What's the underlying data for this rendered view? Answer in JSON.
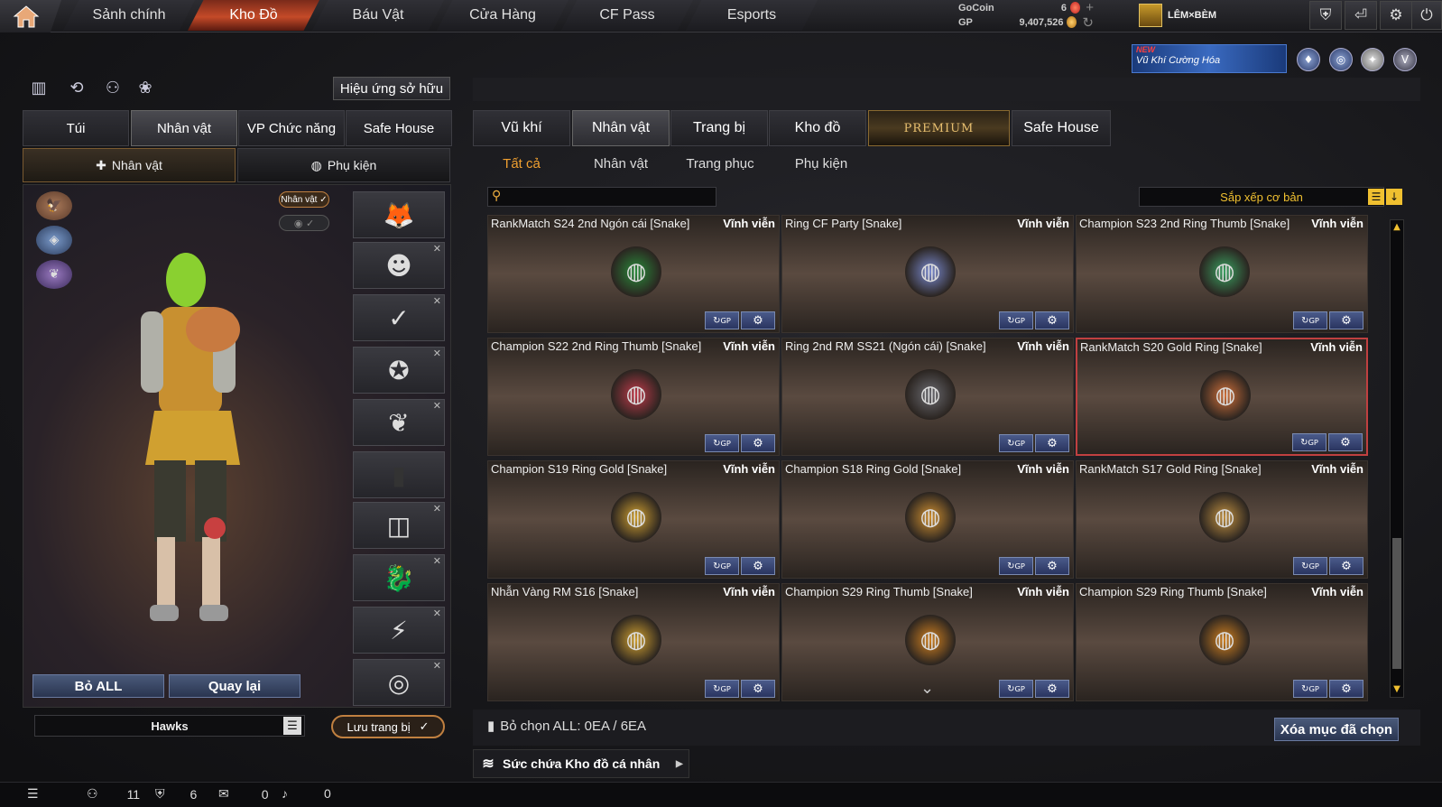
{
  "nav": {
    "tabs": [
      "Sảnh chính",
      "Kho Đồ",
      "Báu Vật",
      "Cửa Hàng",
      "CF Pass",
      "Esports"
    ],
    "active": "Kho Đồ"
  },
  "currency": {
    "gocoin_label": "GoCoin",
    "gocoin_value": "6",
    "gp_label": "GP",
    "gp_value": "9,407,526",
    "plus": "+",
    "refresh": "↻"
  },
  "clan": {
    "name": "LÊM×BÈM"
  },
  "banner": {
    "new": "NEW",
    "text": "Vũ Khí Cường Hóa"
  },
  "left": {
    "effects_button": "Hiệu ứng sở hữu",
    "tabs": [
      "Túi",
      "Nhân vật",
      "VP Chức năng",
      "Safe House"
    ],
    "subtabs": [
      "Nhân vật",
      "Phụ kiện"
    ],
    "char_tag": "Nhân vật ✓",
    "remove_all": "Bỏ ALL",
    "back": "Quay lại",
    "preset_name": "Hawks",
    "save_button": "Lưu trang bị",
    "save_check": "✓"
  },
  "right": {
    "tabs": [
      "Vũ khí",
      "Nhân vật",
      "Trang bị",
      "Kho đồ",
      "PREMIUM",
      "Safe House"
    ],
    "filters": [
      "Tất cả",
      "Nhân vật",
      "Trang phục",
      "Phụ kiện"
    ],
    "sort_label": "Sắp xếp cơ bản",
    "items": [
      {
        "name": "RankMatch S24 2nd Ngón cái [Snake]",
        "duration": "Vĩnh viễn",
        "color": "#2a8a3a"
      },
      {
        "name": "Ring CF Party [Snake]",
        "duration": "Vĩnh viễn",
        "color": "#7a8ad0"
      },
      {
        "name": "Champion S23 2nd Ring Thumb [Snake]",
        "duration": "Vĩnh viễn",
        "color": "#3aa060"
      },
      {
        "name": "Champion S22 2nd Ring Thumb [Snake]",
        "duration": "Vĩnh viễn",
        "color": "#c03a4a"
      },
      {
        "name": "Ring 2nd RM SS21 (Ngón cái) [Snake]",
        "duration": "Vĩnh viễn",
        "color": "#6a6a70"
      },
      {
        "name": "RankMatch S20 Gold Ring [Snake]",
        "duration": "Vĩnh viễn",
        "color": "#d0703a"
      },
      {
        "name": "Champion S19 Ring Gold [Snake]",
        "duration": "Vĩnh viễn",
        "color": "#d0a030"
      },
      {
        "name": "Champion S18 Ring Gold [Snake]",
        "duration": "Vĩnh viễn",
        "color": "#d09030"
      },
      {
        "name": "RankMatch S17 Gold Ring [Snake]",
        "duration": "Vĩnh viễn",
        "color": "#c09040"
      },
      {
        "name": "Nhẫn Vàng RM S16 [Snake]",
        "duration": "Vĩnh viễn",
        "color": "#d0a030"
      },
      {
        "name": "Champion S29 Ring Thumb [Snake]",
        "duration": "Vĩnh viễn",
        "color": "#d08020"
      },
      {
        "name": "Champion S29 Ring Thumb [Snake]",
        "duration": "Vĩnh viễn",
        "color": "#d08020"
      }
    ],
    "gp_label": "GP",
    "deselect_all": "Bỏ chọn ALL: 0EA / 6EA",
    "delete_selected": "Xóa mục đã chọn",
    "capacity": "Sức chứa Kho đồ cá nhân"
  },
  "status": {
    "players": "11",
    "clan": "6",
    "chat": "0",
    "sound": "0"
  }
}
